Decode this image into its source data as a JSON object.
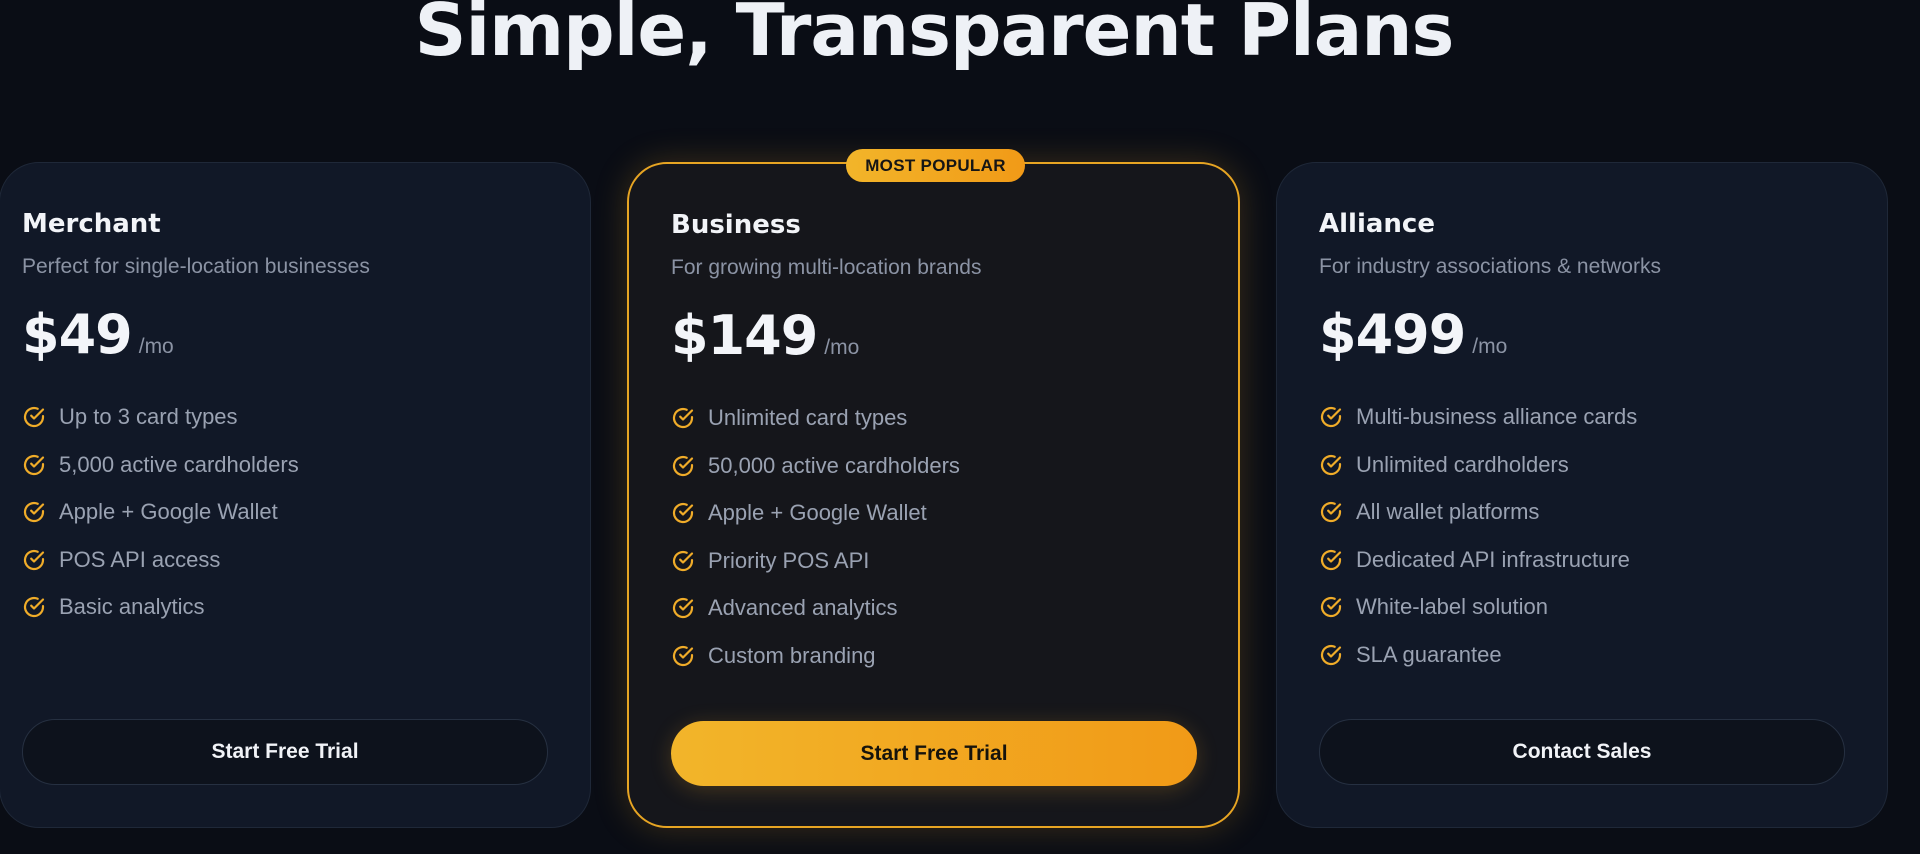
{
  "header": {
    "title": "Simple, Transparent Plans"
  },
  "theme": {
    "accent": "#f2aa28",
    "background": "#0a0d15",
    "card_background": "#111827"
  },
  "plans": [
    {
      "name": "Merchant",
      "description": "Perfect for single-location businesses",
      "price": "$49",
      "period": "/mo",
      "features": [
        "Up to 3 card types",
        "5,000 active cardholders",
        "Apple + Google Wallet",
        "POS API access",
        "Basic analytics"
      ],
      "cta": "Start Free Trial"
    },
    {
      "name": "Business",
      "badge": "MOST POPULAR",
      "description": "For growing multi-location brands",
      "price": "$149",
      "period": "/mo",
      "features": [
        "Unlimited card types",
        "50,000 active cardholders",
        "Apple + Google Wallet",
        "Priority POS API",
        "Advanced analytics",
        "Custom branding"
      ],
      "cta": "Start Free Trial"
    },
    {
      "name": "Alliance",
      "description": "For industry associations & networks",
      "price": "$499",
      "period": "/mo",
      "features": [
        "Multi-business alliance cards",
        "Unlimited cardholders",
        "All wallet platforms",
        "Dedicated API infrastructure",
        "White-label solution",
        "SLA guarantee"
      ],
      "cta": "Contact Sales"
    }
  ],
  "icons": {
    "feature_check": "check-circle-icon"
  }
}
